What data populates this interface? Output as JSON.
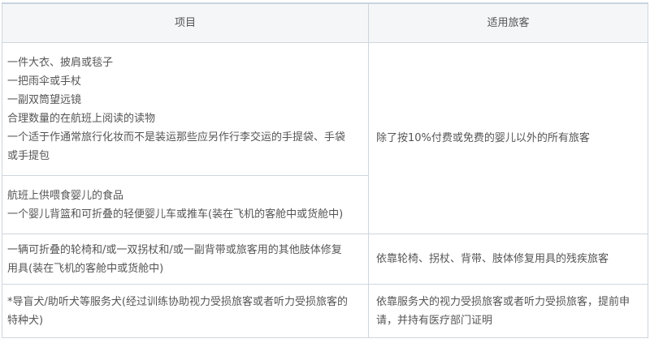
{
  "header": {
    "col_item": "项目",
    "col_passenger": "适用旅客"
  },
  "rows": [
    {
      "items": [
        "一件大衣、披肩或毯子",
        "一把雨伞或手杖",
        "一副双筒望远镜",
        "合理数量的在航班上阅读的读物",
        "一个适于作通常旅行化妆而不是装运那些应另作行李交运的手提袋、手袋",
        "或手提包"
      ]
    },
    {
      "items": [
        "航班上供喂食婴儿的食品",
        "一个婴儿背篮和可折叠的轻便婴儿车或推车(装在飞机的客舱中或货舱中)"
      ]
    },
    {
      "items": [
        "一辆可折叠的轮椅和/或一双拐杖和/或一副背带或旅客用的其他肢体修复",
        "用具(装在飞机的客舱中或货舱中)"
      ],
      "passenger": [
        "依靠轮椅、拐杖、背带、肢体修复用具的残疾旅客"
      ]
    },
    {
      "items": [
        "*导盲犬/助听犬等服务犬(经过训练协助视力受损旅客或者听力受损旅客的",
        "特种犬)"
      ],
      "passenger": [
        "依靠服务犬的视力受损旅客或者听力受损旅客，提前申",
        "请，并持有医疗部门证明"
      ]
    }
  ],
  "shared_passenger_rows_1_2": "除了按10%付费或免费的婴儿以外的所有旅客"
}
